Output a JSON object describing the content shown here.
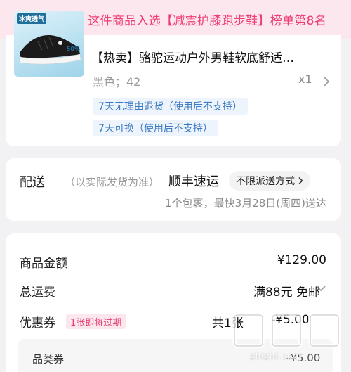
{
  "banner": {
    "text": "有眼光！这件商品入选【减震护膝跑步鞋】榜单第8名",
    "icon": "trophy-icon",
    "color": "#ee3d74"
  },
  "product": {
    "thumb_tag": "冰爽透气",
    "thumb_pct": "50%",
    "title": "【热卖】骆驼运动户外男鞋软底舒适…",
    "spec": "黑色；42",
    "qty": "x1",
    "services": [
      "7天无理由退货（使用后不支持）",
      "7天可换（使用后不支持）"
    ]
  },
  "shipping": {
    "label": "配送",
    "note": "（以实际发货为准）",
    "carrier": "顺丰速运",
    "method": "不限派送方式",
    "eta": "1个包裹，最快3月28日(周四)送达"
  },
  "costs": {
    "goods_label": "商品金额",
    "goods_value": "¥129.00",
    "freight_label": "总运费",
    "freight_value": "满88元 免邮",
    "coupon_label": "优惠券",
    "coupon_badge": "1张即将过期",
    "coupon_count": "共1张",
    "coupon_amount": "-¥5.00",
    "category_coupon_label": "品类券",
    "category_coupon_amount": "-¥5.00"
  },
  "watermark": {
    "text": "zhizhi.com"
  }
}
